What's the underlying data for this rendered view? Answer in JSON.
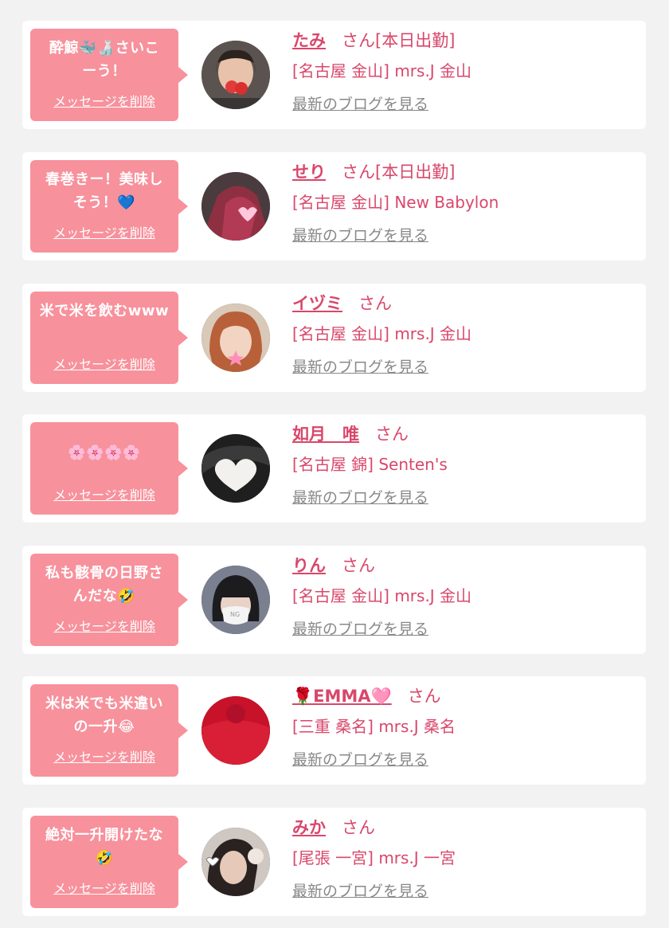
{
  "items": [
    {
      "message": "酔鯨🐳🍶さいこ\nーう！",
      "delete_label": "メッセージを削除",
      "name": "たみ",
      "honorific": "さん",
      "status": "[本日出勤]",
      "store": "[名古屋 金山] mrs.J 金山",
      "blog_label": "最新のブログを見る",
      "avatar_icon": "profile-photo-icon"
    },
    {
      "message": "春巻きー！美味し\nそう！💙",
      "delete_label": "メッセージを削除",
      "name": "せり",
      "honorific": "さん",
      "status": "[本日出勤]",
      "store": "[名古屋 金山] New Babylon",
      "blog_label": "最新のブログを見る",
      "avatar_icon": "profile-photo-icon"
    },
    {
      "message": "米で米を飲むwww",
      "delete_label": "メッセージを削除",
      "name": "イヅミ",
      "honorific": "さん",
      "status": "",
      "store": "[名古屋 金山] mrs.J 金山",
      "blog_label": "最新のブログを見る",
      "avatar_icon": "profile-photo-icon"
    },
    {
      "message": "🌸🌸🌸🌸",
      "delete_label": "メッセージを削除",
      "name": "如月　唯",
      "honorific": "さん",
      "status": "",
      "store": "[名古屋 錦] Senten's",
      "blog_label": "最新のブログを見る",
      "avatar_icon": "profile-photo-icon"
    },
    {
      "message": "私も骸骨の日野さ\nんだな🤣",
      "delete_label": "メッセージを削除",
      "name": "りん",
      "honorific": "さん",
      "status": "",
      "store": "[名古屋 金山] mrs.J 金山",
      "blog_label": "最新のブログを見る",
      "avatar_icon": "profile-photo-icon"
    },
    {
      "message": "米は米でも米違い\nの一升😂",
      "delete_label": "メッセージを削除",
      "name": "🌹EMMA🩷",
      "honorific": "さん",
      "status": "",
      "store": "[三重 桑名] mrs.J 桑名",
      "blog_label": "最新のブログを見る",
      "avatar_icon": "profile-photo-icon"
    },
    {
      "message": "絶対一升開けたな\n🤣",
      "delete_label": "メッセージを削除",
      "name": "みか",
      "honorific": "さん",
      "status": "",
      "store": "[尾張 一宮] mrs.J 一宮",
      "blog_label": "最新のブログを見る",
      "avatar_icon": "profile-photo-icon"
    }
  ],
  "colors": {
    "bubble": "#f7919c",
    "name": "#d9476b",
    "link_gray": "#888888",
    "background": "#f2f2f2"
  }
}
